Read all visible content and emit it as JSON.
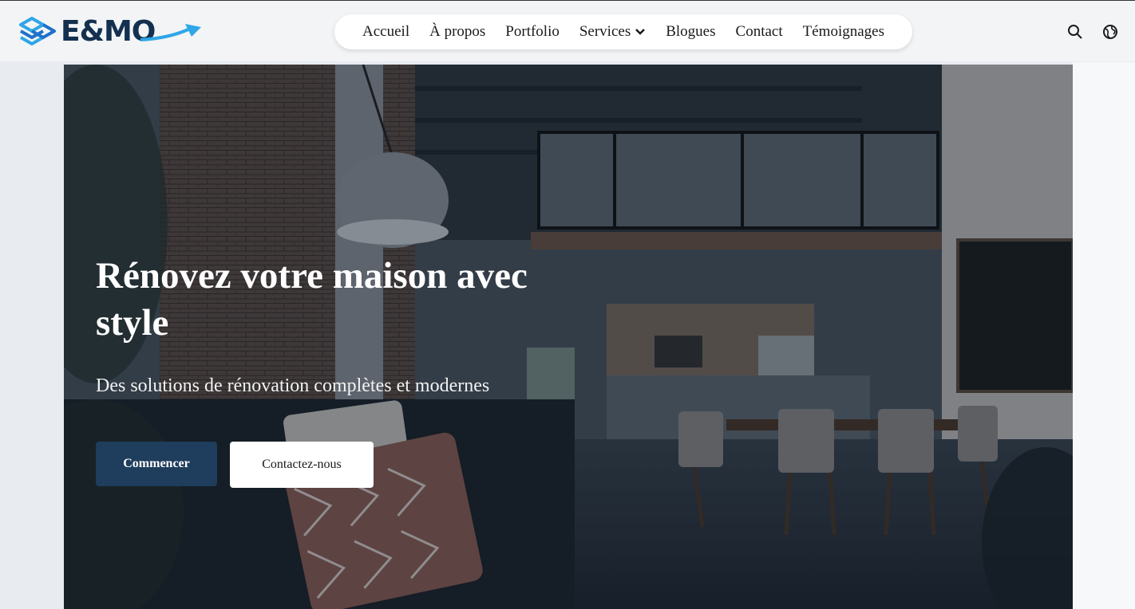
{
  "brand": {
    "logo_text": "E&MO",
    "colors": {
      "primary": "#14304f",
      "accent": "#2fa6e6",
      "button": "#1f3d5c"
    }
  },
  "nav": {
    "items": [
      {
        "label": "Accueil"
      },
      {
        "label": "À propos"
      },
      {
        "label": "Portfolio"
      },
      {
        "label": "Services",
        "has_dropdown": true
      },
      {
        "label": "Blogues"
      },
      {
        "label": "Contact"
      },
      {
        "label": "Témoignages"
      }
    ]
  },
  "header_icons": [
    "search-icon",
    "language-globe-icon"
  ],
  "hero": {
    "image": "loft-interior-photo",
    "title": "Rénovez votre maison avec style",
    "subtitle": "Des solutions de rénovation complètes et modernes",
    "primary_button": "Commencer",
    "secondary_button": "Contactez-nous"
  }
}
